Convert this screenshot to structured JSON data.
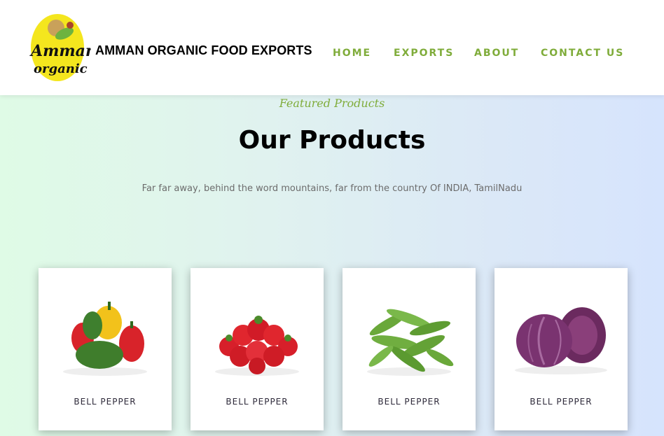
{
  "brand": {
    "logo_line1": "Amman",
    "logo_line2": "organic",
    "name": "AMMAN ORGANIC FOOD EXPORTS"
  },
  "nav": {
    "items": [
      "HOME",
      "EXPORTS",
      "ABOUT",
      "CONTACT US"
    ]
  },
  "section": {
    "eyebrow": "Featured Products",
    "title": "Our Products",
    "subtitle": "Far far away, behind the word mountains, far from the country Of INDIA, TamilNadu"
  },
  "products": [
    {
      "label": "BELL PEPPER",
      "image": "bell-peppers"
    },
    {
      "label": "BELL PEPPER",
      "image": "strawberries"
    },
    {
      "label": "BELL PEPPER",
      "image": "snow-peas"
    },
    {
      "label": "BELL PEPPER",
      "image": "red-cabbage"
    }
  ],
  "colors": {
    "accent": "#7fac3a",
    "logo_yellow": "#f4e61e",
    "text_dark": "#000000",
    "muted": "#6c6c6c"
  }
}
